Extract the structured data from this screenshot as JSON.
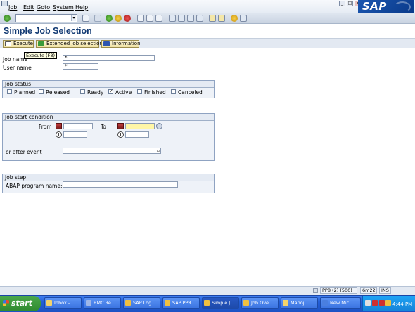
{
  "menu": {
    "items": [
      "Job",
      "Edit",
      "Goto",
      "System",
      "Help"
    ]
  },
  "sap_logo": "SAP",
  "window_controls": [
    "_",
    "□",
    "×"
  ],
  "screen_title": "Simple Job Selection",
  "app_toolbar": {
    "execute": "Execute",
    "extended": "Extended job selection",
    "information": "Information"
  },
  "tooltip": "Execute   (F8)",
  "fields": {
    "job_name_label": "Job name",
    "job_name_value": "*",
    "user_name_label": "User name",
    "user_name_value": "*"
  },
  "job_status": {
    "heading": "Job status",
    "options": [
      {
        "label": "Planned",
        "checked": false
      },
      {
        "label": "Released",
        "checked": false
      },
      {
        "label": "Ready",
        "checked": false
      },
      {
        "label": "Active",
        "checked": true
      },
      {
        "label": "Finished",
        "checked": false
      },
      {
        "label": "Canceled",
        "checked": false
      }
    ]
  },
  "job_start": {
    "heading": "Job start condition",
    "from_label": "From",
    "to_label": "To",
    "after_event_label": "or after event"
  },
  "job_step": {
    "heading": "Job step",
    "abap_label": "ABAP program name:"
  },
  "status_bar": {
    "system": "PP8 (2) (500)",
    "server": "6m22",
    "mode": "INS"
  },
  "taskbar": {
    "start": "start",
    "buttons": [
      "Inbox - ...",
      "BMC Re...",
      "SAP Log...",
      "SAP PP8...",
      "Simple J...",
      "Job Ove...",
      "Manoj",
      "New Mic..."
    ],
    "active_index": 4,
    "clock": "4:44 PM"
  },
  "colors": {
    "title": "#123a73",
    "required_field": "#fff6a6",
    "taskbar": "#235ed6",
    "start_button": "#2f8a2f"
  }
}
